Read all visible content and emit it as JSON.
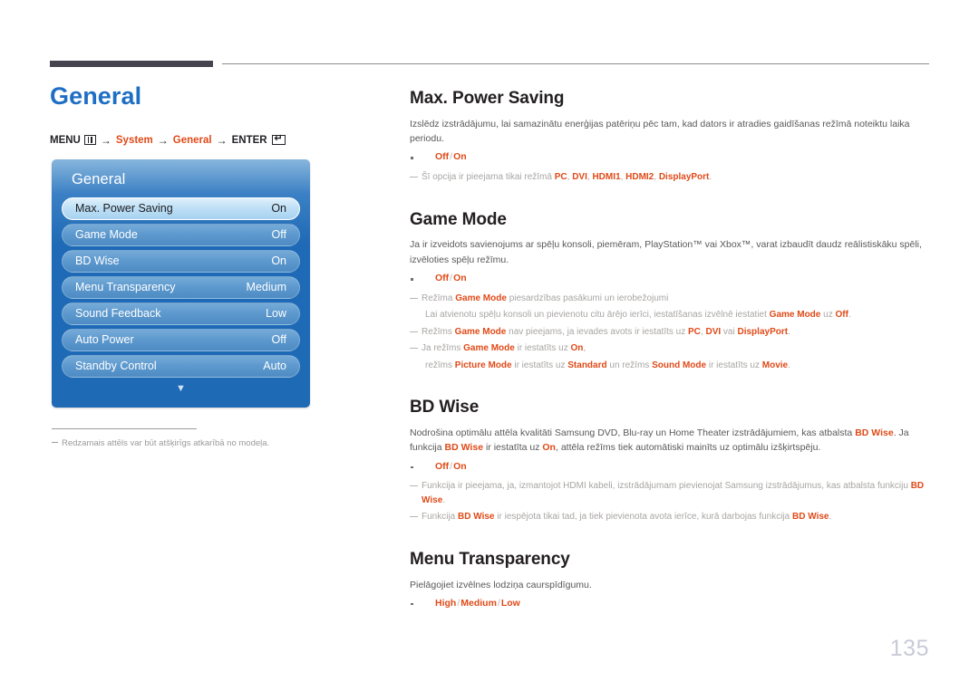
{
  "page": {
    "title": "General",
    "number": "135"
  },
  "breadcrumb": {
    "menu_label": "MENU",
    "menu_icon": "menu-grid-icon",
    "arrow": "→",
    "item1": "System",
    "item2": "General",
    "enter_label": "ENTER",
    "enter_icon": "enter-return-icon"
  },
  "osd": {
    "title": "General",
    "more_icon": "chevron-down-icon",
    "rows": [
      {
        "label": "Max. Power Saving",
        "value": "On",
        "selected": true
      },
      {
        "label": "Game Mode",
        "value": "Off",
        "selected": false
      },
      {
        "label": "BD Wise",
        "value": "On",
        "selected": false
      },
      {
        "label": "Menu Transparency",
        "value": "Medium",
        "selected": false
      },
      {
        "label": "Sound Feedback",
        "value": "Low",
        "selected": false
      },
      {
        "label": "Auto Power",
        "value": "Off",
        "selected": false
      },
      {
        "label": "Standby Control",
        "value": "Auto",
        "selected": false
      }
    ]
  },
  "left_note": "Redzamais attēls var būt atšķirīgs atkarībā no modeļa.",
  "sections": {
    "max_power_saving": {
      "title": "Max. Power Saving",
      "body": "Izslēdz izstrādājumu, lai samazinātu enerģijas patēriņu pēc tam, kad dators ir atradies gaidīšanas režīmā noteiktu laika periodu.",
      "options": [
        "Off",
        "On"
      ],
      "note1_a": "Šī opcija ir pieejama tikai režīmā ",
      "note1_hl1": "PC",
      "note1_b": ", ",
      "note1_hl2": "DVI",
      "note1_c": ", ",
      "note1_hl3": "HDMI1",
      "note1_d": ", ",
      "note1_hl4": "HDMI2",
      "note1_e": ", ",
      "note1_hl5": "DisplayPort",
      "note1_f": "."
    },
    "game_mode": {
      "title": "Game Mode",
      "body_a": "Ja ir izveidots savienojums ar spēļu konsoli, piemēram, PlayStation™ vai Xbox™, varat izbaudīt daudz reālistiskāku spēli, izvēloties spēļu režīmu.",
      "options": [
        "Off",
        "On"
      ],
      "note1_a": "Režīma ",
      "note1_hl1": "Game Mode",
      "note1_b": " piesardzības pasākumi un ierobežojumi",
      "note2_a": "Lai atvienotu spēļu konsoli un pievienotu citu ārējo ierīci, iestatīšanas izvēlnē iestatiet ",
      "note2_hl1": "Game Mode",
      "note2_b": " uz ",
      "note2_hl2": "Off",
      "note2_c": ".",
      "note3_a": "Režīms ",
      "note3_hl1": "Game Mode",
      "note3_b": " nav pieejams, ja ievades avots ir iestatīts uz ",
      "note3_hl2": "PC",
      "note3_c": ", ",
      "note3_hl3": "DVI",
      "note3_d": " vai ",
      "note3_hl4": "DisplayPort",
      "note3_e": ".",
      "note4_a": "Ja režīms ",
      "note4_hl1": "Game Mode",
      "note4_b": " ir iestatīts uz ",
      "note4_hl2": "On",
      "note4_c": ",",
      "note5_a": "režīms ",
      "note5_hl1": "Picture Mode",
      "note5_b": " ir iestatīts uz ",
      "note5_hl2": "Standard",
      "note5_c": " un režīms ",
      "note5_hl3": "Sound Mode",
      "note5_d": " ir iestatīts uz ",
      "note5_hl4": "Movie",
      "note5_e": "."
    },
    "bd_wise": {
      "title": "BD Wise",
      "body_a": "Nodrošina optimālu attēla kvalitāti Samsung DVD, Blu-ray un Home Theater izstrādājumiem, kas atbalsta ",
      "body_hl1": "BD Wise",
      "body_b": ". Ja funkcija ",
      "body_hl2": "BD Wise",
      "body_c": " ir iestatīta uz ",
      "body_hl3": "On",
      "body_d": ", attēla režīms tiek automātiski mainīts uz optimālu izšķirtspēju.",
      "options": [
        "Off",
        "On"
      ],
      "note1_a": "Funkcija ir pieejama, ja, izmantojot HDMI kabeli, izstrādājumam pievienojat Samsung izstrādājumus, kas atbalsta funkciju ",
      "note1_hl1": "BD Wise",
      "note1_b": ".",
      "note2_a": "Funkcija ",
      "note2_hl1": "BD Wise",
      "note2_b": " ir iespējota tikai tad, ja tiek pievienota avota ierīce, kurā darbojas funkcija ",
      "note2_hl2": "BD Wise",
      "note2_c": "."
    },
    "menu_transparency": {
      "title": "Menu Transparency",
      "body": "Pielāgojiet izvēlnes lodziņa caurspīdīgumu.",
      "options": [
        "High",
        "Medium",
        "Low"
      ]
    }
  },
  "colors": {
    "accent_orange": "#e04a18",
    "title_blue": "#1e6fc4",
    "osd_blue": "#1e6ab5",
    "body_gray": "#59595b",
    "note_gray": "#a8a6a4",
    "page_number": "#c9cad8"
  }
}
